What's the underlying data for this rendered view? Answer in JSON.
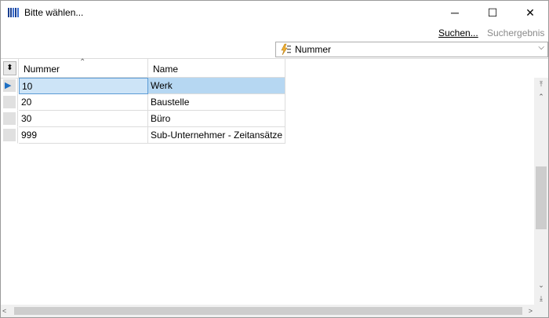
{
  "window": {
    "title": "Bitte wählen..."
  },
  "title_controls": {
    "minimize": "─",
    "maximize": "☐",
    "close": "✕"
  },
  "toolbar": {
    "search_label": "Suchen...",
    "result_label": "Suchergebnis"
  },
  "filter": {
    "selected_field": "Nummer"
  },
  "grid": {
    "columns": [
      "Nummer",
      "Name"
    ],
    "sorted_column": "Nummer",
    "rows": [
      {
        "nummer": "10",
        "name": "Werk",
        "selected": true
      },
      {
        "nummer": "20",
        "name": "Baustelle",
        "selected": false
      },
      {
        "nummer": "30",
        "name": "Büro",
        "selected": false
      },
      {
        "nummer": "999",
        "name": "Sub-Unternehmer - Zeitansätze",
        "selected": false
      }
    ]
  },
  "colors": {
    "selection": "#b6d7f2",
    "indicator": "#1d6fc4",
    "disabled_text": "#8a8a8a"
  },
  "icons": [
    "app-grid-icon",
    "lightning-list-icon",
    "sort-asc-icon",
    "row-pointer-icon"
  ]
}
